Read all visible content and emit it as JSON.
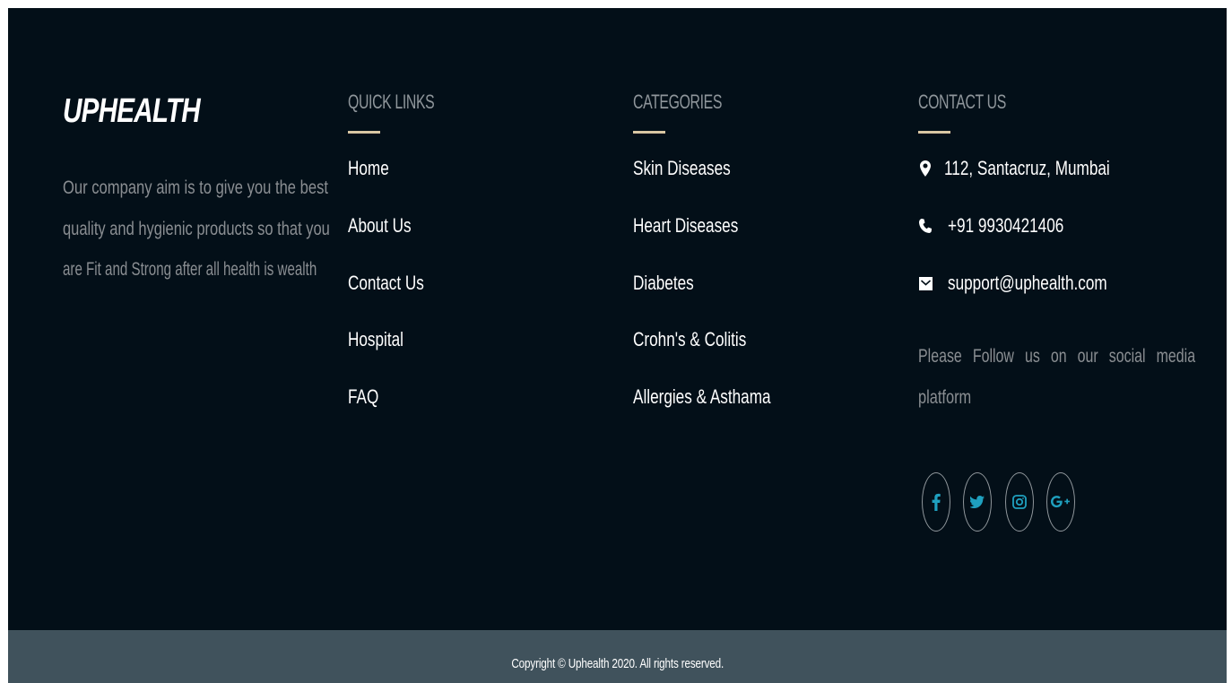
{
  "brand": {
    "name": "UPHEALTH"
  },
  "about": {
    "text_line1": "Our company aim is to give you the best",
    "text_line2": "quality and hygienic products so that you",
    "text_line3": "are Fit and Strong after all health is wealth"
  },
  "quick_links": {
    "heading": "QUICK LINKS",
    "items": [
      "Home",
      "About Us",
      "Contact Us",
      "Hospital",
      "FAQ"
    ]
  },
  "categories": {
    "heading": "CATEGORIES",
    "items": [
      "Skin Diseases",
      "Heart Diseases",
      "Diabetes",
      "Crohn's & Colitis",
      "Allergies & Asthama"
    ]
  },
  "contact": {
    "heading": "CONTACT US",
    "address": "112, Santacruz, Mumbai",
    "phone": "+91 9930421406",
    "email": "support@uphealth.com",
    "follow_line1": "Please Follow us on our social media",
    "follow_line2": "platform",
    "social_icons": [
      "facebook-icon",
      "twitter-icon",
      "instagram-icon",
      "google-plus-icon"
    ]
  },
  "footer": {
    "copyright": "Copyright © Uphealth 2020. All rights reserved."
  },
  "colors": {
    "background": "#030f18",
    "bottom_bar": "#40525c",
    "accent_underline": "#d9c7a3",
    "social_icon": "#1fa0bf"
  }
}
